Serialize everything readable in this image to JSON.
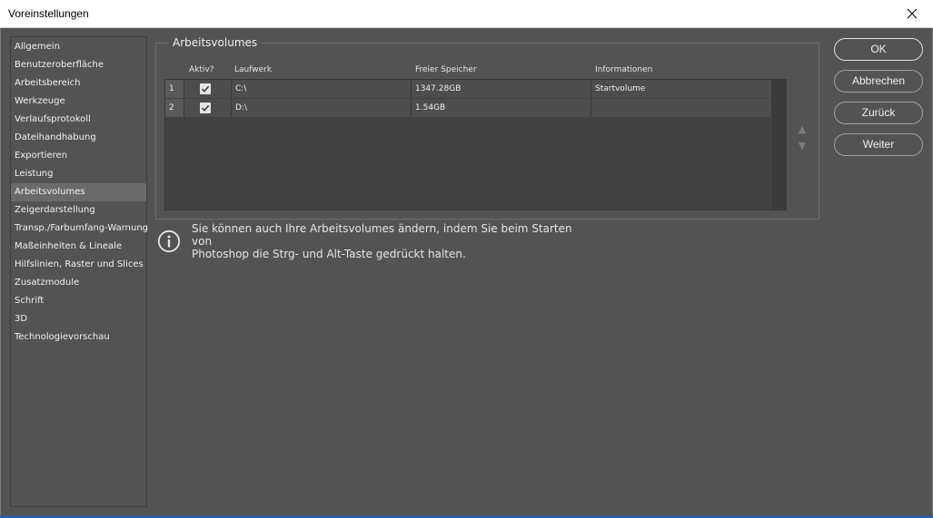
{
  "window": {
    "title": "Voreinstellungen"
  },
  "sidebar": {
    "items": [
      {
        "label": "Allgemein"
      },
      {
        "label": "Benutzeroberfläche"
      },
      {
        "label": "Arbeitsbereich"
      },
      {
        "label": "Werkzeuge"
      },
      {
        "label": "Verlaufsprotokoll"
      },
      {
        "label": "Dateihandhabung"
      },
      {
        "label": "Exportieren"
      },
      {
        "label": "Leistung"
      },
      {
        "label": "Arbeitsvolumes",
        "selected": true
      },
      {
        "label": "Zeigerdarstellung"
      },
      {
        "label": "Transp./Farbumfang-Warnung"
      },
      {
        "label": "Maßeinheiten & Lineale"
      },
      {
        "label": "Hilfslinien, Raster und Slices"
      },
      {
        "label": "Zusatzmodule"
      },
      {
        "label": "Schrift"
      },
      {
        "label": "3D"
      },
      {
        "label": "Technologievorschau"
      }
    ]
  },
  "volumes": {
    "group_title": "Arbeitsvolumes",
    "headers": {
      "active": "Aktiv?",
      "drive": "Laufwerk",
      "free": "Freier Speicher",
      "info": "Informationen"
    },
    "rows": [
      {
        "num": "1",
        "active": true,
        "drive": "C:\\",
        "free": "1347.28GB",
        "info": "Startvolume"
      },
      {
        "num": "2",
        "active": true,
        "drive": "D:\\",
        "free": "1.54GB",
        "info": ""
      }
    ],
    "move_up_icon": "triangle-up",
    "move_down_icon": "triangle-down"
  },
  "hint": {
    "icon": "info-icon",
    "line1": "Sie können auch Ihre Arbeitsvolumes ändern, indem Sie beim Starten von",
    "line2": "Photoshop die Strg- und Alt-Taste gedrückt halten."
  },
  "buttons": {
    "ok": "OK",
    "cancel": "Abbrechen",
    "back": "Zurück",
    "next": "Weiter"
  }
}
